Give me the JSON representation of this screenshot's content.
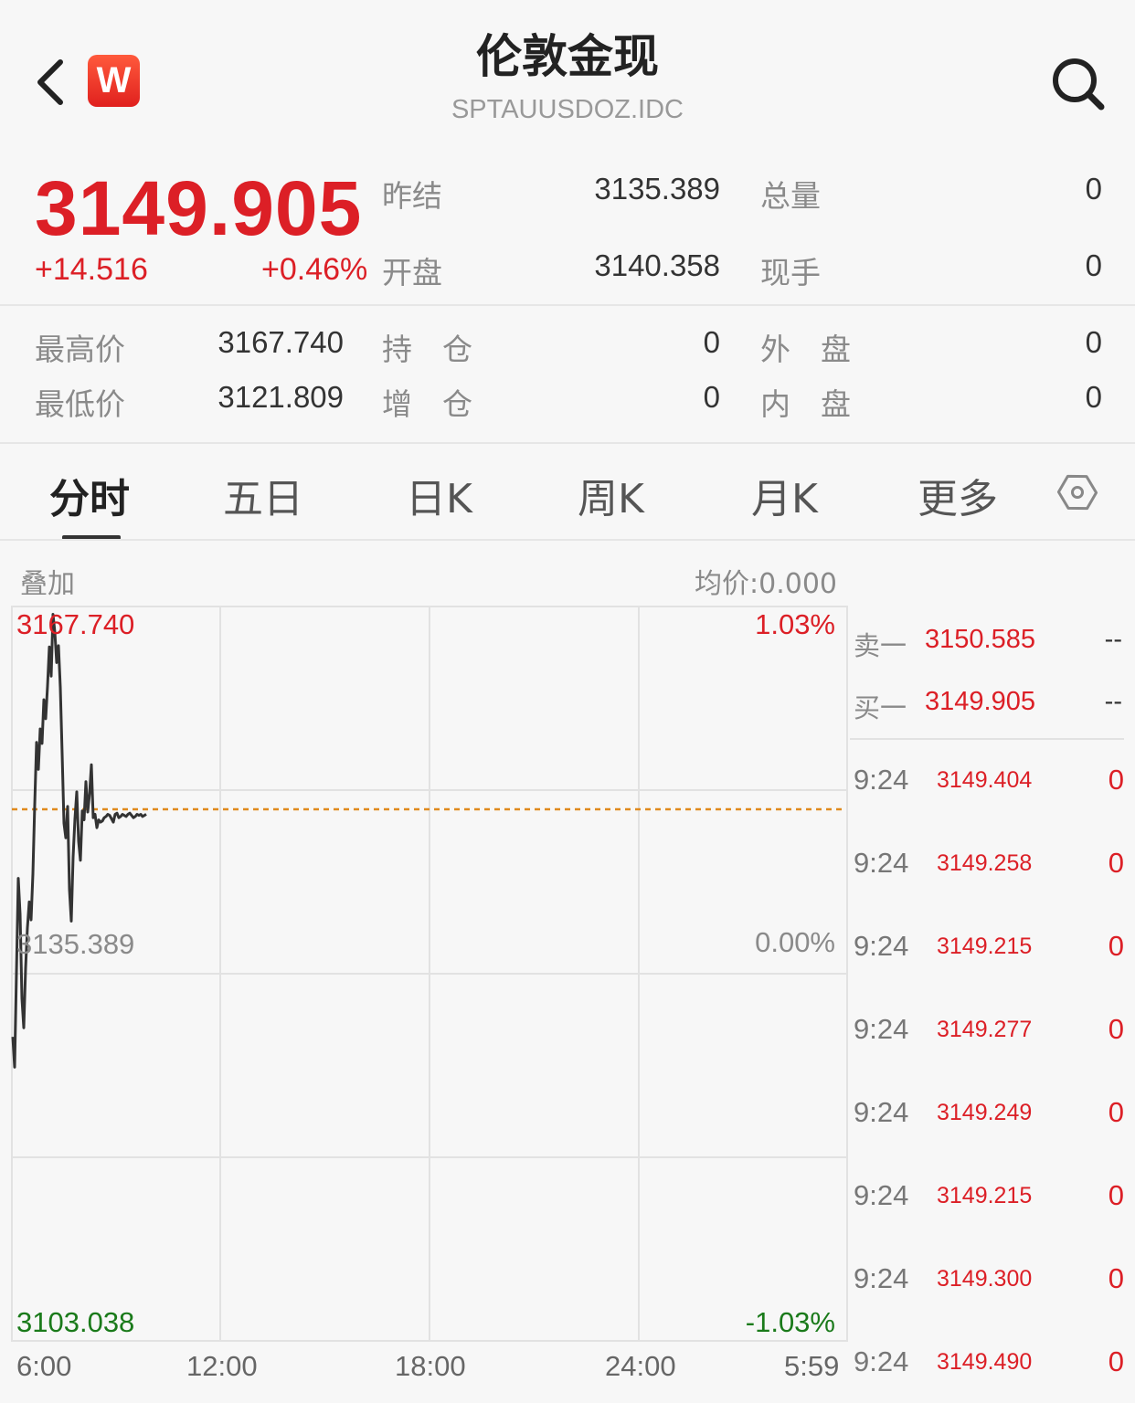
{
  "header": {
    "title": "伦敦金现",
    "symbol": "SPTAUUSDOZ.IDC",
    "logo_letter": "W"
  },
  "quote": {
    "price": "3149.905",
    "change": "+14.516",
    "change_pct": "+0.46%",
    "prev_settle_label": "昨结",
    "prev_settle": "3135.389",
    "open_label": "开盘",
    "open": "3140.358",
    "total_vol_label": "总量",
    "total_vol": "0",
    "cur_vol_label": "现手",
    "cur_vol": "0",
    "high_label": "最高价",
    "high": "3167.740",
    "low_label": "最低价",
    "low": "3121.809",
    "oi_label": "持　仓",
    "oi": "0",
    "oi_chg_label": "增　仓",
    "oi_chg": "0",
    "outer_label": "外　盘",
    "outer": "0",
    "inner_label": "内　盘",
    "inner": "0"
  },
  "tabs": [
    "分时",
    "五日",
    "日K",
    "周K",
    "月K",
    "更多"
  ],
  "chart": {
    "overlay_label": "叠加",
    "avg_price": "均价:0.000",
    "top_price": "3167.740",
    "mid_price": "3135.389",
    "bottom_price": "3103.038",
    "top_pct": "1.03%",
    "mid_pct": "0.00%",
    "bottom_pct": "-1.03%",
    "times": [
      "6:00",
      "12:00",
      "18:00",
      "24:00",
      "5:59"
    ]
  },
  "chart_data": {
    "type": "line",
    "ylim": [
      3103.038,
      3167.74
    ],
    "reference": 3135.389,
    "x": [
      0,
      2,
      4,
      6,
      8,
      10,
      12,
      14,
      16,
      18,
      20,
      22,
      24,
      26,
      28,
      30,
      32,
      34,
      36,
      38,
      40,
      42,
      44,
      46,
      48,
      50,
      52,
      54,
      56,
      58,
      60,
      62,
      64,
      66,
      68,
      70,
      72,
      74,
      76,
      78,
      80,
      82,
      84,
      86,
      88,
      90,
      92,
      94,
      96,
      98,
      100,
      102,
      104,
      106,
      108,
      110,
      112,
      114,
      116,
      118,
      120,
      122,
      124,
      126,
      128,
      130,
      132,
      134,
      136,
      138,
      140,
      142,
      144,
      146
    ],
    "values": [
      3130.1,
      3127.4,
      3135.8,
      3144.2,
      3141.0,
      3133.5,
      3130.9,
      3136.2,
      3139.8,
      3142.1,
      3140.5,
      3144.6,
      3150.8,
      3156.3,
      3153.9,
      3157.5,
      3156.2,
      3160.1,
      3158.4,
      3161.3,
      3164.8,
      3162.2,
      3167.7,
      3166.1,
      3163.4,
      3164.9,
      3161.2,
      3155.3,
      3149.1,
      3147.8,
      3150.6,
      3143.2,
      3140.4,
      3146.1,
      3149.5,
      3151.9,
      3147.5,
      3145.8,
      3150.2,
      3149.4,
      3152.8,
      3150.1,
      3151.7,
      3154.3,
      3149.6,
      3149.9,
      3148.7,
      3149.4,
      3149.2,
      3149.3,
      3149.6,
      3149.7,
      3149.9,
      3149.8,
      3149.5,
      3149.2,
      3149.9,
      3150.0,
      3149.6,
      3149.7,
      3149.9,
      3149.8,
      3149.7,
      3149.9,
      3150.0,
      3149.8,
      3149.6,
      3149.7,
      3149.9,
      3149.8,
      3149.9,
      3149.7,
      3149.8,
      3149.905
    ]
  },
  "order_book": {
    "sell1_label": "卖一",
    "sell1_price": "3150.585",
    "sell1_qty": "--",
    "buy1_label": "买一",
    "buy1_price": "3149.905",
    "buy1_qty": "--"
  },
  "ticks": [
    {
      "time": "9:24",
      "price": "3149.404",
      "vol": "0"
    },
    {
      "time": "9:24",
      "price": "3149.258",
      "vol": "0"
    },
    {
      "time": "9:24",
      "price": "3149.215",
      "vol": "0"
    },
    {
      "time": "9:24",
      "price": "3149.277",
      "vol": "0"
    },
    {
      "time": "9:24",
      "price": "3149.249",
      "vol": "0"
    },
    {
      "time": "9:24",
      "price": "3149.215",
      "vol": "0"
    },
    {
      "time": "9:24",
      "price": "3149.300",
      "vol": "0"
    },
    {
      "time": "9:24",
      "price": "3149.490",
      "vol": "0"
    }
  ],
  "colors": {
    "up": "#dc1f26",
    "down": "#1a7a1a",
    "ref_line": "#e08a1e"
  }
}
